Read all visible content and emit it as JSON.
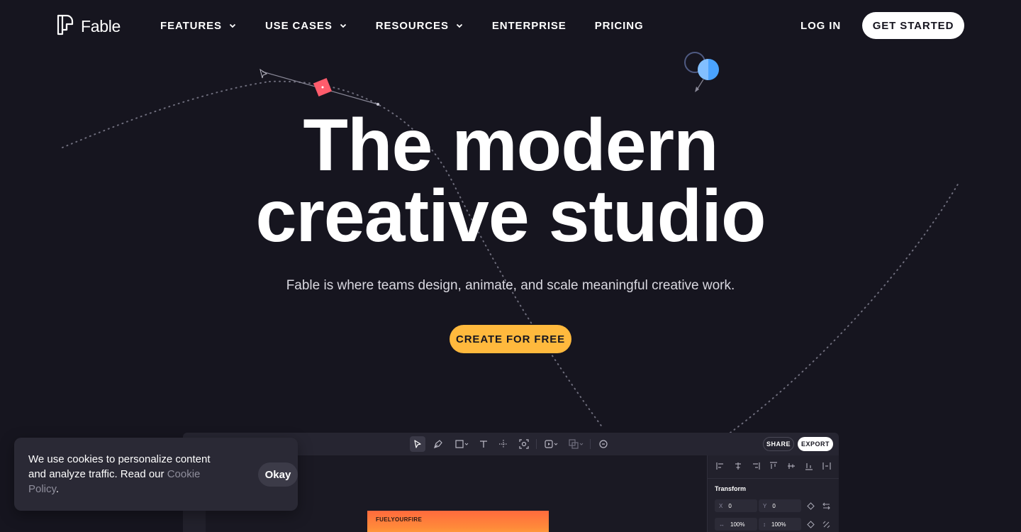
{
  "brand": {
    "name": "Fable",
    "logo_icon": "fable-logo-icon"
  },
  "nav": {
    "items": [
      {
        "label": "FEATURES",
        "has_dropdown": true
      },
      {
        "label": "USE CASES",
        "has_dropdown": true
      },
      {
        "label": "RESOURCES",
        "has_dropdown": true
      },
      {
        "label": "ENTERPRISE",
        "has_dropdown": false
      },
      {
        "label": "PRICING",
        "has_dropdown": false
      }
    ],
    "login": "LOG IN",
    "cta": "GET STARTED"
  },
  "hero": {
    "title_line1": "The modern",
    "title_line2": "creative studio",
    "subtitle": "Fable is where teams design, animate, and scale meaningful creative work.",
    "cta": "CREATE FOR FREE"
  },
  "app_preview": {
    "toolbar_icons": [
      "select-cursor-icon",
      "pen-icon",
      "rectangle-icon",
      "text-icon",
      "move-icon",
      "focus-icon",
      "play-icon",
      "shapes-icon",
      "comment-icon"
    ],
    "share_label": "SHARE",
    "export_label": "EXPORT",
    "panel": {
      "section_title": "Transform",
      "fields": [
        {
          "key": "X",
          "value": "0"
        },
        {
          "key": "Y",
          "value": "0"
        },
        {
          "key": "↔",
          "value": "100%"
        },
        {
          "key": "↕",
          "value": "100%"
        }
      ]
    },
    "artboard_label": "FUELYOURFIRE"
  },
  "cookie": {
    "text": "We use cookies to personalize content and analyze traffic. Read our ",
    "link": "Cookie Policy",
    "suffix": ".",
    "button": "Okay"
  },
  "colors": {
    "background": "#16151f",
    "accent": "#ffb93d",
    "coral": "#ff5c6c",
    "blue": "#4aa3ff"
  }
}
